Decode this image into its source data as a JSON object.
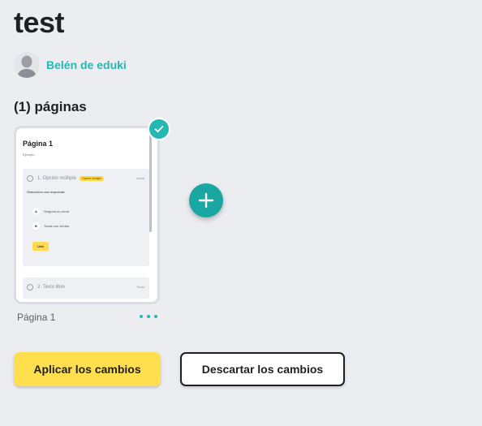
{
  "title": "test",
  "author": {
    "name": "Belén de eduki"
  },
  "pages_heading": "(1) páginas",
  "page_card": {
    "label": "Página 1",
    "selected": true,
    "thumbnail": {
      "title": "Página 1",
      "subtitle": "Ejemplo",
      "question1": {
        "label": "1. Opción múltiple",
        "tag": "Opción múltiple",
        "type": "Única",
        "prompt": "Selecciona una respuesta:",
        "options": [
          {
            "letter": "A",
            "text": "Ninguna es cierta"
          },
          {
            "letter": "B",
            "text": "Todas son ciertas"
          }
        ],
        "button": "Listo"
      },
      "question2": {
        "label": "2. Texto libre",
        "type": "Texto"
      }
    }
  },
  "actions": {
    "apply_label": "Aplicar los cambios",
    "discard_label": "Descartar los cambios"
  },
  "colors": {
    "accent": "#27b7b3",
    "apply_button": "#ffdf4e",
    "background": "#ecedf1"
  },
  "icons": {
    "check": "check-icon",
    "add": "plus-icon",
    "more": "more-dots-icon",
    "avatar": "user-avatar"
  }
}
